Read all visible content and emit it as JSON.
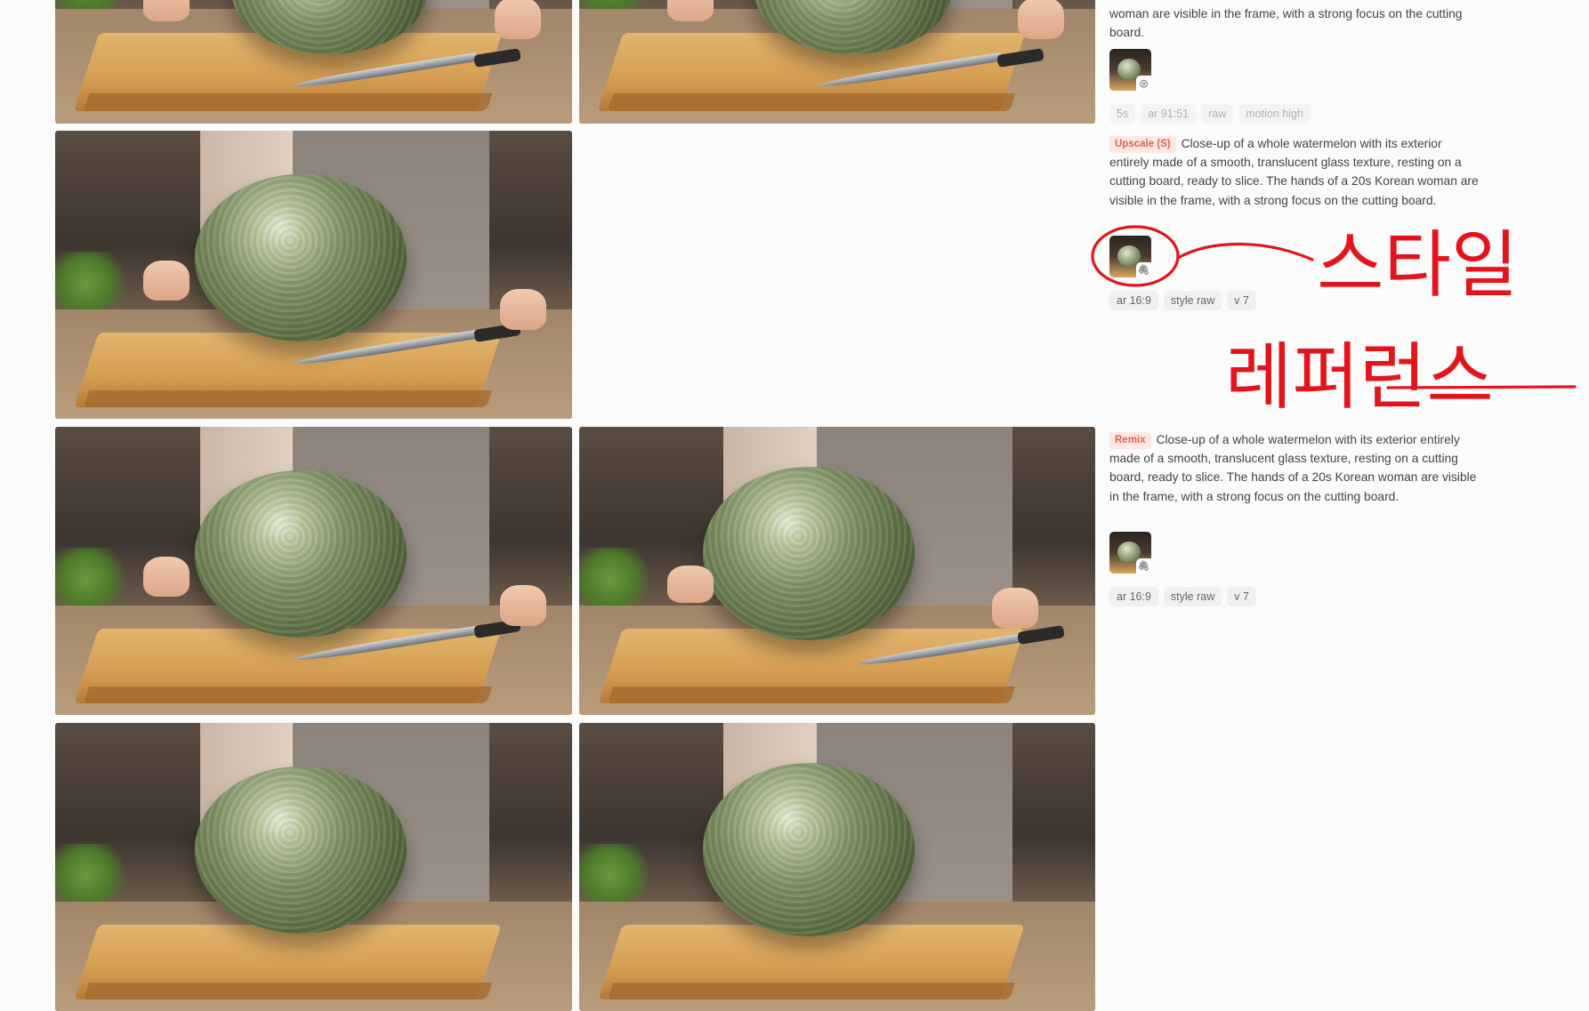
{
  "entries": [
    {
      "prompt_tail": "woman are visible in the frame, with a strong focus on the cutting board.",
      "tags": [
        "5s",
        "ar 91:51",
        "raw",
        "motion high"
      ],
      "thumb_icon": "eye-icon",
      "thumb_glyph": "◎"
    },
    {
      "badge": "Upscale (S)",
      "prompt": "Close-up of a whole watermelon with its exterior entirely made of a smooth, translucent glass texture, resting on a cutting board, ready to slice. The hands of a 20s Korean woman are visible in the frame, with a strong focus on the cutting board.",
      "tags": [
        "ar 16:9",
        "style raw",
        "v 7"
      ],
      "thumb_icon": "paperclip-icon",
      "thumb_glyph": "🖇"
    },
    {
      "badge": "Remix",
      "prompt": "Close-up of a whole watermelon with its exterior entirely made of a smooth, translucent glass texture, resting on a cutting board, ready to slice. The hands of a 20s Korean woman are visible in the frame, with a strong focus on the cutting board.",
      "tags": [
        "ar 16:9",
        "style raw",
        "v 7"
      ],
      "thumb_icon": "paperclip-icon",
      "thumb_glyph": "🖇"
    }
  ],
  "annotation": {
    "color": "#e3141c",
    "line1": "스타일",
    "line2": "레퍼런스"
  }
}
